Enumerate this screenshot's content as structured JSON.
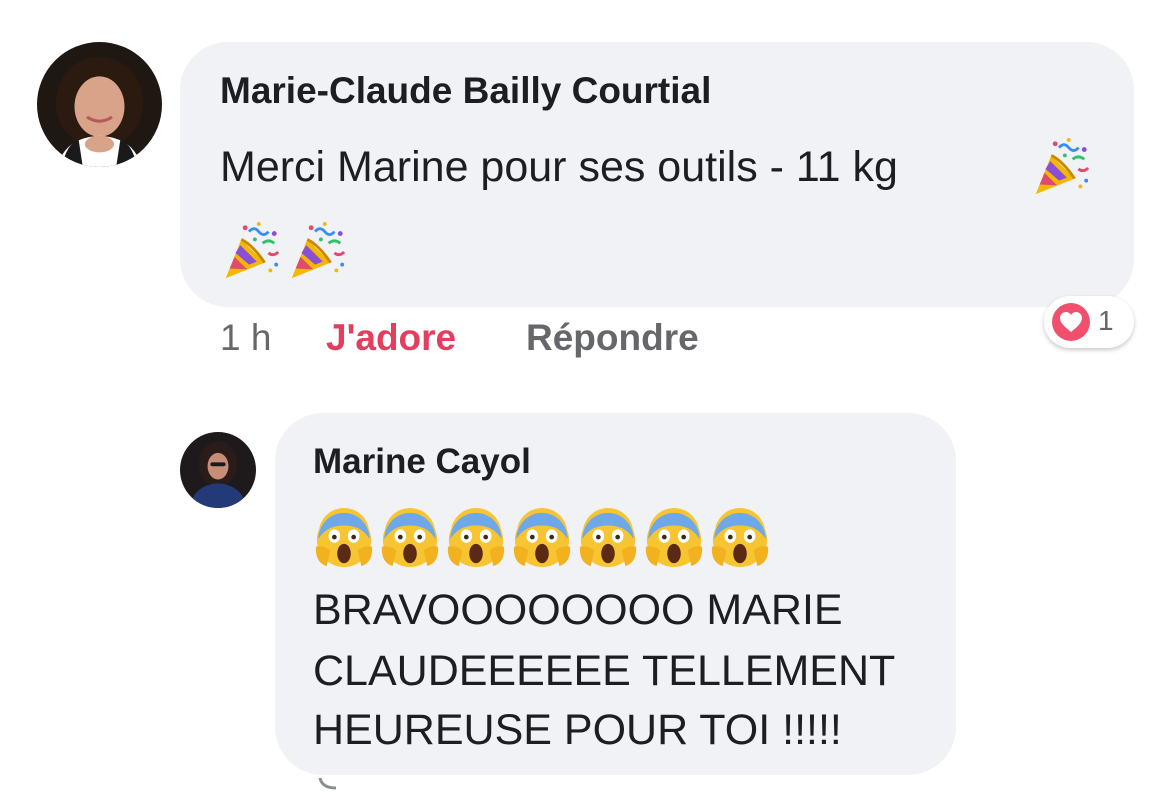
{
  "comments": [
    {
      "author": "Marie-Claude Bailly Courtial",
      "text": "Merci Marine pour ses outils - 11 kg",
      "emojis": [
        "party-popper",
        "party-popper",
        "party-popper"
      ],
      "time": "1 h",
      "like_label": "J'adore",
      "reply_label": "Répondre",
      "reaction": {
        "icon": "heart-reaction-icon",
        "count": "1",
        "color": "#f0506e"
      }
    },
    {
      "author": "Marine Cayol",
      "emojis": [
        "face-screaming-in-fear",
        "face-screaming-in-fear",
        "face-screaming-in-fear",
        "face-screaming-in-fear",
        "face-screaming-in-fear",
        "face-screaming-in-fear",
        "face-screaming-in-fear"
      ],
      "text_lines": [
        "BRAVOOOOOOOO MARIE",
        "CLAUDEEEEEE TELLEMENT",
        "HEUREUSE POUR TOI !!!!!"
      ]
    }
  ],
  "colors": {
    "bubble": "#f0f2f5",
    "text": "#1c1e21",
    "muted": "#65676b",
    "like_active": "#e23f5e"
  }
}
